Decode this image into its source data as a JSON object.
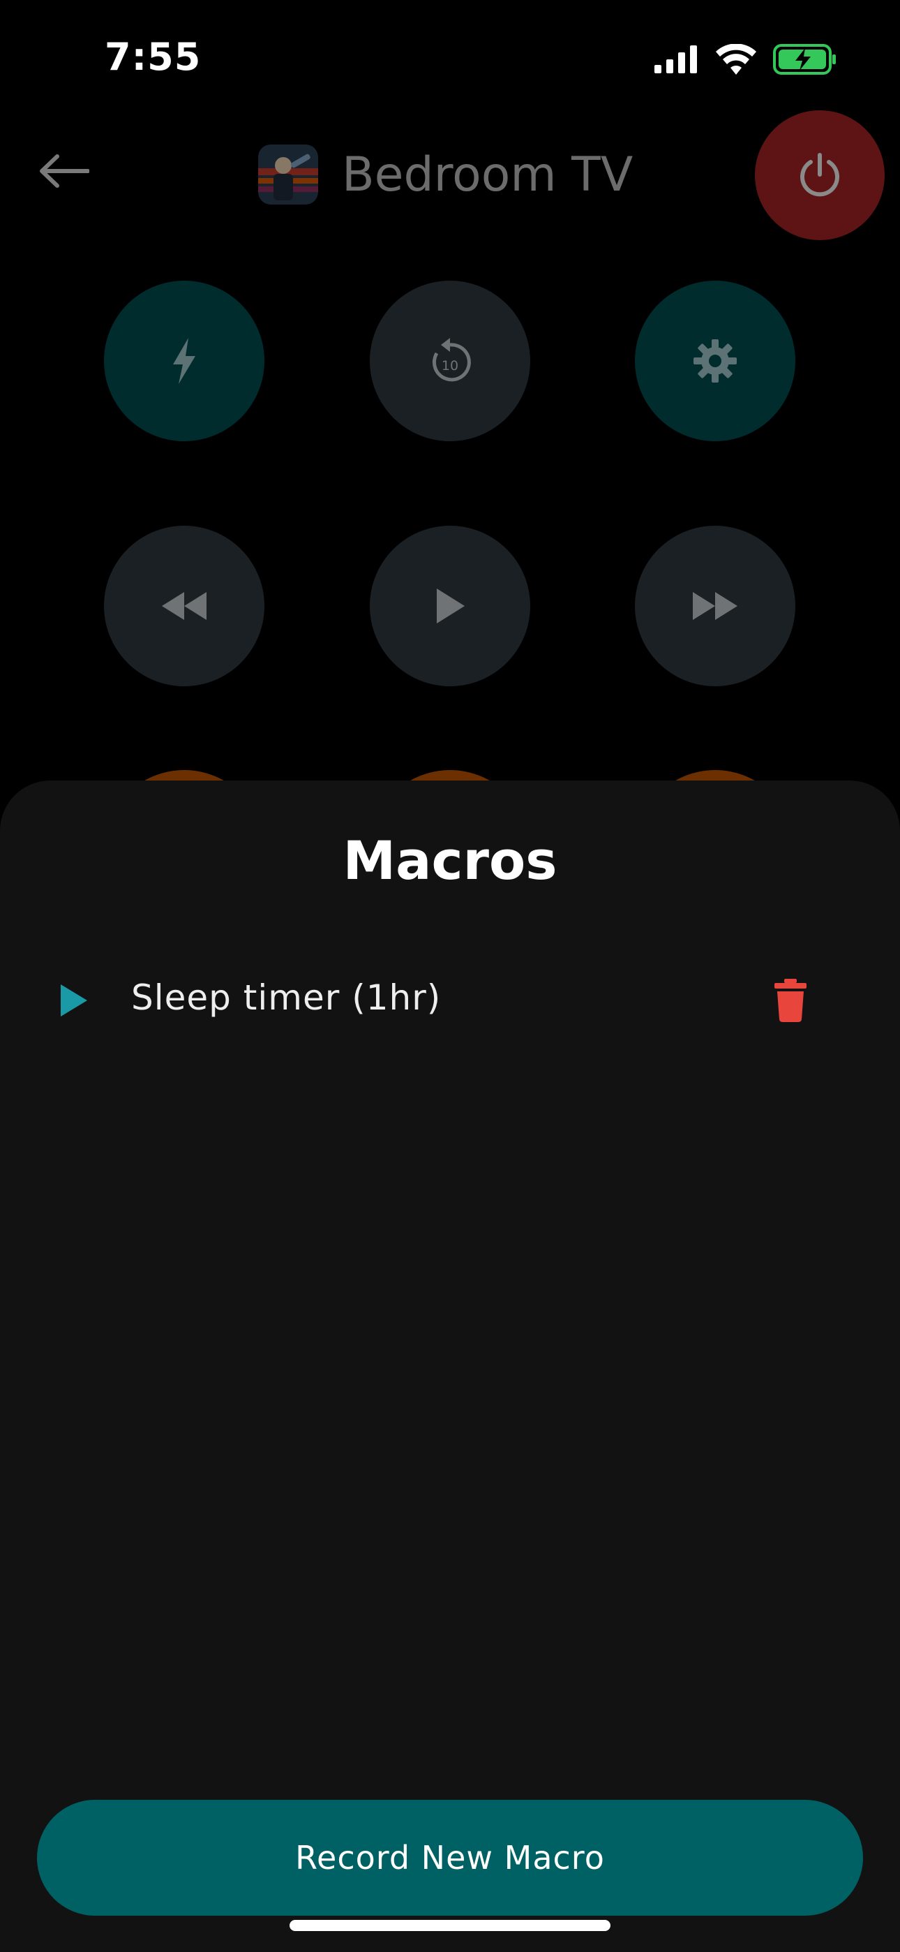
{
  "status_bar": {
    "time": "7:55",
    "icons": [
      "cellular-signal-icon",
      "wifi-icon",
      "battery-charging-icon"
    ]
  },
  "header": {
    "title": "Bedroom TV",
    "back_icon": "arrow-left-icon",
    "power_icon": "power-icon"
  },
  "controls": {
    "row1": [
      {
        "icon": "lightning-bolt-icon",
        "style": "teal"
      },
      {
        "icon": "replay-10-icon",
        "replay_label": "10",
        "style": "grey"
      },
      {
        "icon": "gear-icon",
        "style": "teal"
      }
    ],
    "row2": [
      {
        "icon": "rewind-icon",
        "style": "grey"
      },
      {
        "icon": "play-icon",
        "style": "grey"
      },
      {
        "icon": "fast-forward-icon",
        "style": "grey"
      }
    ]
  },
  "sheet": {
    "title": "Macros",
    "macros": [
      {
        "label": "Sleep timer (1hr)",
        "play_icon": "play-icon",
        "delete_icon": "trash-icon"
      }
    ],
    "record_button_label": "Record New Macro"
  },
  "colors": {
    "accent_teal": "#006165",
    "play_icon": "#1a99a6",
    "delete_icon": "#e8453c",
    "power_bg": "#5e1414",
    "sheet_bg": "#121212",
    "battery": "#34c759"
  }
}
